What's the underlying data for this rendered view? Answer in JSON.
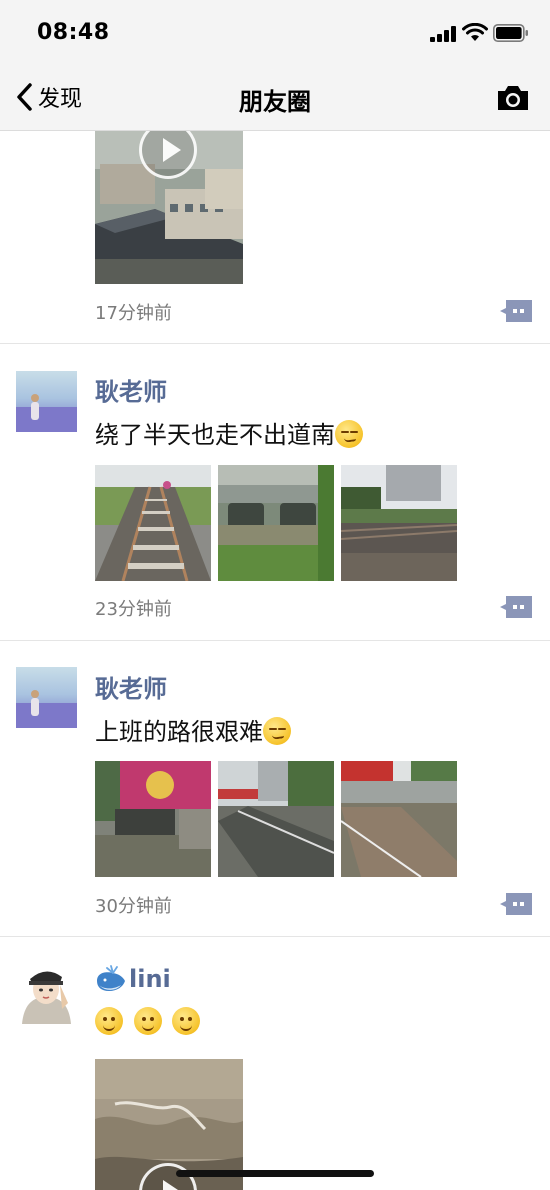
{
  "status_bar": {
    "time": "08:48"
  },
  "nav": {
    "back_label": "发现",
    "title": "朋友圈"
  },
  "posts": [
    {
      "time_ago": "17分钟前"
    },
    {
      "author": "耿老师",
      "text": "绕了半天也走不出道南",
      "time_ago": "23分钟前"
    },
    {
      "author": "耿老师",
      "text": "上班的路很艰难",
      "time_ago": "30分钟前"
    },
    {
      "author": "lini"
    }
  ],
  "colors": {
    "author_link": "#576b95",
    "nav_bg": "#f4f4f4",
    "comment_btn": "#8b96b8"
  },
  "icons": [
    "back-chevron-icon",
    "camera-icon",
    "comment-icon",
    "play-icon",
    "signal-icon",
    "wifi-icon",
    "battery-icon",
    "whale-icon",
    "smile-emoji-icon",
    "smirk-emoji-icon"
  ]
}
